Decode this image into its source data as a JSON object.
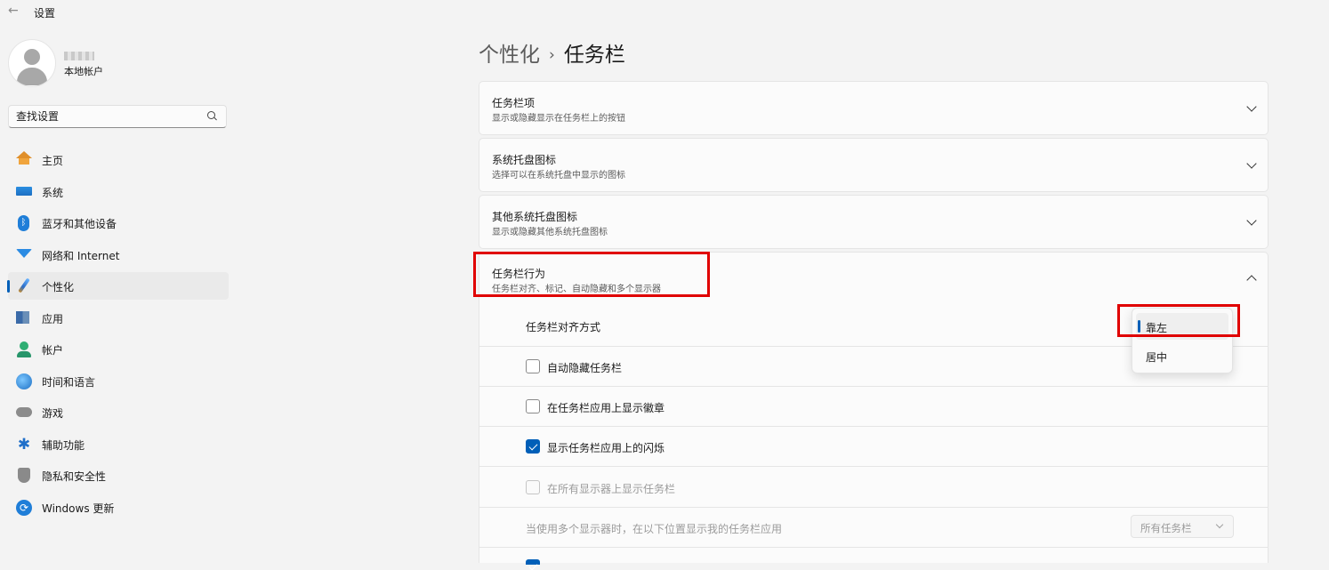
{
  "window": {
    "title": "设置",
    "back_icon": "back-arrow-icon"
  },
  "account": {
    "name_redacted": true,
    "type": "本地帐户"
  },
  "search": {
    "placeholder": "查找设置",
    "icon": "search-icon"
  },
  "sidebar": {
    "items": [
      {
        "label": "主页",
        "icon": "home-icon"
      },
      {
        "label": "系统",
        "icon": "system-icon"
      },
      {
        "label": "蓝牙和其他设备",
        "icon": "bluetooth-icon"
      },
      {
        "label": "网络和 Internet",
        "icon": "wifi-icon"
      },
      {
        "label": "个性化",
        "icon": "brush-icon",
        "active": true
      },
      {
        "label": "应用",
        "icon": "apps-icon"
      },
      {
        "label": "帐户",
        "icon": "account-icon"
      },
      {
        "label": "时间和语言",
        "icon": "globe-clock-icon"
      },
      {
        "label": "游戏",
        "icon": "gamepad-icon"
      },
      {
        "label": "辅助功能",
        "icon": "accessibility-icon"
      },
      {
        "label": "隐私和安全性",
        "icon": "shield-icon"
      },
      {
        "label": "Windows 更新",
        "icon": "update-icon"
      }
    ]
  },
  "breadcrumb": {
    "parent": "个性化",
    "separator": "›",
    "current": "任务栏"
  },
  "cards": [
    {
      "title": "任务栏项",
      "subtitle": "显示或隐藏显示在任务栏上的按钮",
      "expanded": false
    },
    {
      "title": "系统托盘图标",
      "subtitle": "选择可以在系统托盘中显示的图标",
      "expanded": false
    },
    {
      "title": "其他系统托盘图标",
      "subtitle": "显示或隐藏其他系统托盘图标",
      "expanded": false
    },
    {
      "title": "任务栏行为",
      "subtitle": "任务栏对齐、标记、自动隐藏和多个显示器",
      "expanded": true
    }
  ],
  "behavior": {
    "alignment_label": "任务栏对齐方式",
    "alignment_options": [
      "靠左",
      "居中"
    ],
    "alignment_selected": "靠左",
    "auto_hide": {
      "label": "自动隐藏任务栏",
      "checked": false
    },
    "badges": {
      "label": "在任务栏应用上显示徽章",
      "checked": false
    },
    "flashing": {
      "label": "显示任务栏应用上的闪烁",
      "checked": true
    },
    "all_displays": {
      "label": "在所有显示器上显示任务栏",
      "checked": false,
      "disabled": true
    },
    "multi_display_label": "当使用多个显示器时，在以下位置显示我的任务栏应用",
    "multi_display_value": "所有任务栏",
    "next_row_checked": true
  },
  "colors": {
    "accent": "#005fb8",
    "highlight": "#e00000",
    "background": "#f3f3f3",
    "card": "#fbfbfb"
  }
}
